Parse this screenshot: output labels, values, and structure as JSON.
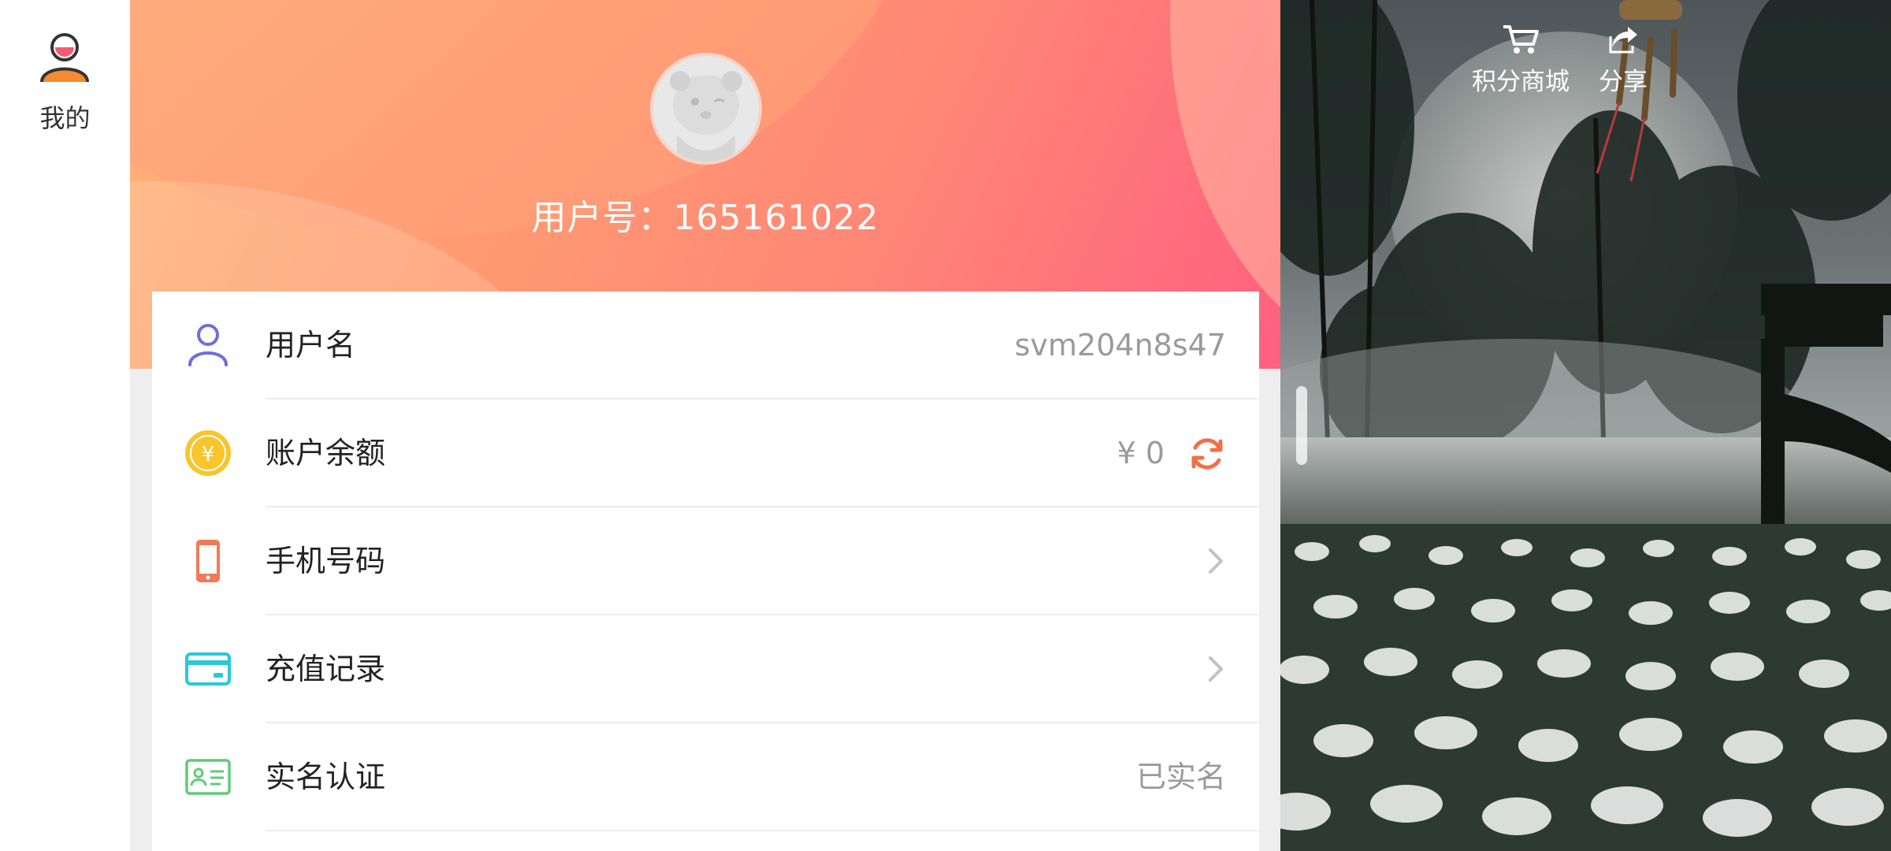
{
  "rail": {
    "tab_label": "我的"
  },
  "profile": {
    "user_id_text": "用户号：165161022"
  },
  "rows": [
    {
      "label": "用户名",
      "value": "svm204n8s47",
      "icon": "person-icon"
    },
    {
      "label": "账户余额",
      "value": "¥ 0",
      "icon": "yuan-coin-icon"
    },
    {
      "label": "手机号码",
      "value": "",
      "icon": "phone-icon"
    },
    {
      "label": "充值记录",
      "value": "",
      "icon": "card-icon"
    },
    {
      "label": "实名认证",
      "value": "已实名",
      "icon": "id-card-icon"
    }
  ],
  "scene": {
    "mall_label": "积分商城",
    "share_label": "分享"
  },
  "colors": {
    "header_start": "#ffb37a",
    "header_end": "#ff6080",
    "refresh_accent": "#f26f45",
    "person_icon": "#6f6ddf",
    "coin_icon": "#f8c52b",
    "phone_icon": "#f07a57",
    "card_icon": "#27c8d8",
    "id_icon": "#5fcb77"
  }
}
